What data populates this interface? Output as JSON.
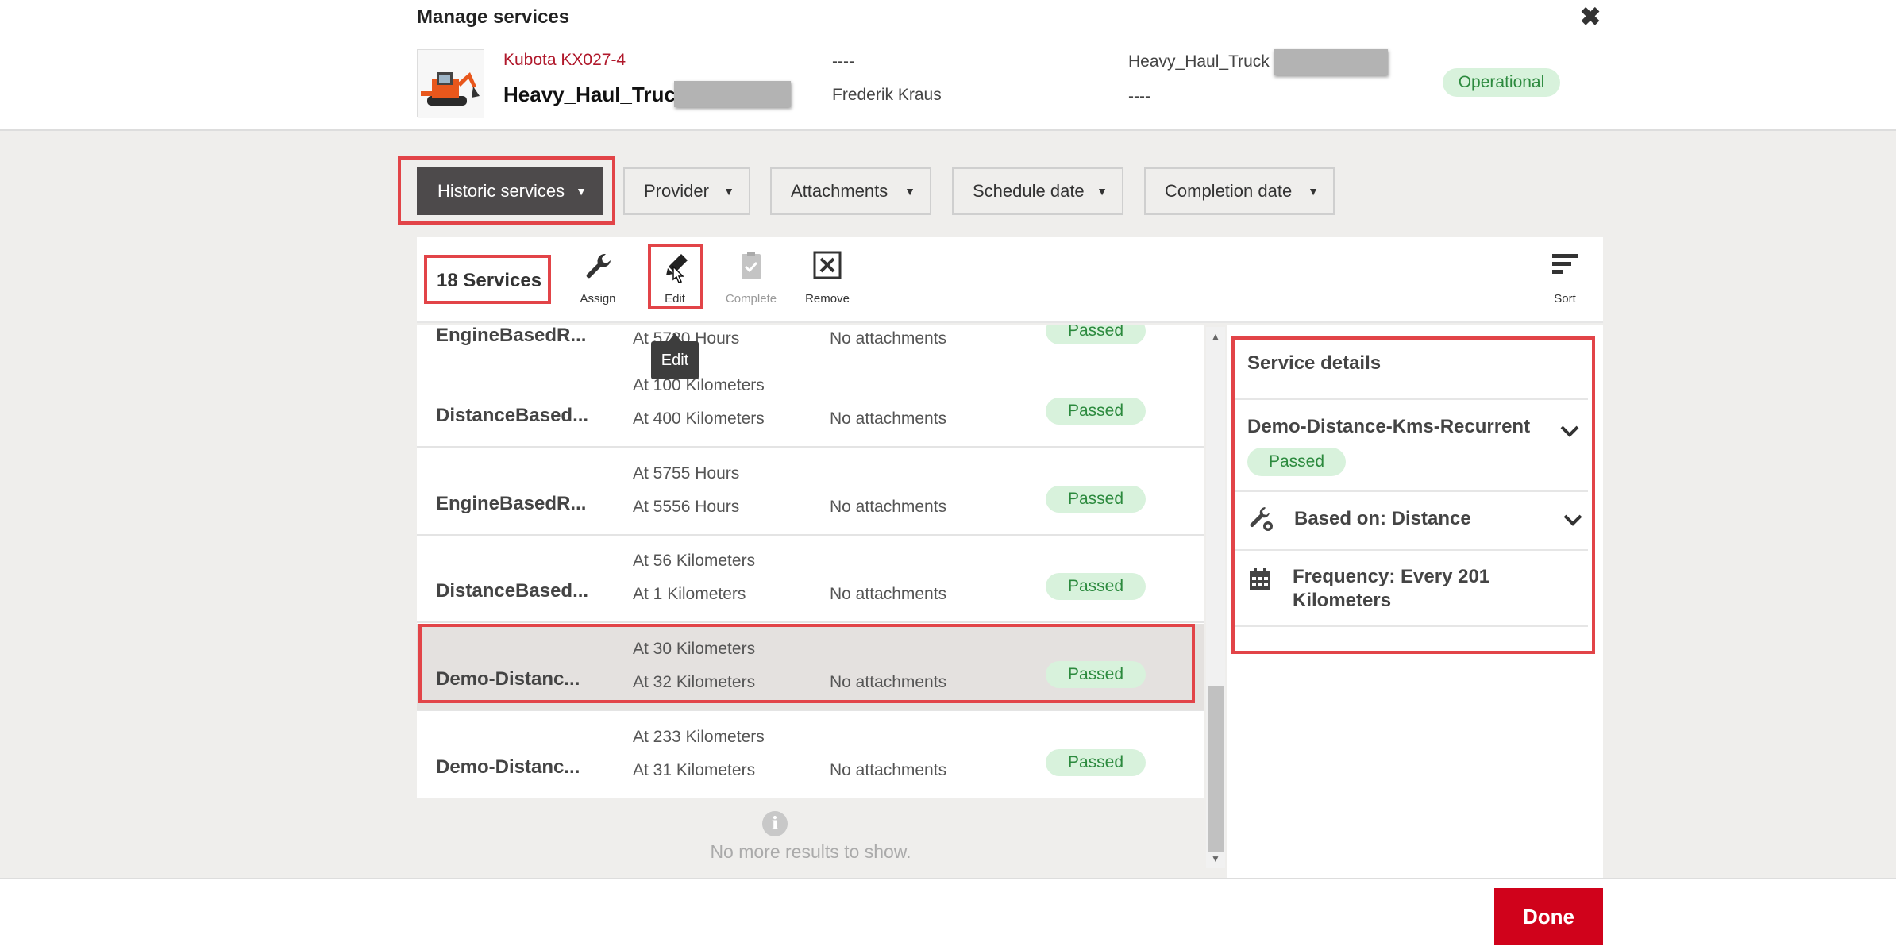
{
  "header": {
    "title": "Manage services",
    "asset_make": "Kubota KX027-4",
    "asset_name": "Heavy_Haul_Truck",
    "field1": "----",
    "owner": "Frederik Kraus",
    "field3": "Heavy_Haul_Truck",
    "field4": "----",
    "status": "Operational"
  },
  "filters": [
    "Historic services",
    "Provider",
    "Attachments",
    "Schedule date",
    "Completion date"
  ],
  "toolbar": {
    "count": "18 Services",
    "assign": "Assign",
    "edit": "Edit",
    "complete": "Complete",
    "remove": "Remove",
    "sort": "Sort",
    "tooltip": "Edit"
  },
  "services": [
    {
      "name": "EngineBasedR...",
      "line1": "",
      "line2": "At 5720 Hours",
      "attachments": "No attachments",
      "status": "Passed"
    },
    {
      "name": "DistanceBased...",
      "line1": "At 100 Kilometers",
      "line2": "At 400 Kilometers",
      "attachments": "No attachments",
      "status": "Passed"
    },
    {
      "name": "EngineBasedR...",
      "line1": "At 5755 Hours",
      "line2": "At 5556 Hours",
      "attachments": "No attachments",
      "status": "Passed"
    },
    {
      "name": "DistanceBased...",
      "line1": "At 56 Kilometers",
      "line2": "At 1 Kilometers",
      "attachments": "No attachments",
      "status": "Passed"
    },
    {
      "name": "Demo-Distanc...",
      "line1": "At 30 Kilometers",
      "line2": "At 32 Kilometers",
      "attachments": "No attachments",
      "status": "Passed"
    },
    {
      "name": "Demo-Distanc...",
      "line1": "At 233 Kilometers",
      "line2": "At 31 Kilometers",
      "attachments": "No attachments",
      "status": "Passed"
    }
  ],
  "list_footer": {
    "info_icon": "i",
    "text": "No more results to show."
  },
  "details": {
    "title": "Service details",
    "name": "Demo-Distance-Kms-Recurrent",
    "status": "Passed",
    "based_on": "Based on: Distance",
    "frequency": "Frequency: Every 201 Kilometers"
  },
  "footer": {
    "done": "Done"
  },
  "colors": {
    "accent": "#d0021b",
    "highlight": "#e24448",
    "passed_bg": "#d8f2dc",
    "passed_text": "#2c8a3e",
    "make_text": "#b0182b"
  }
}
